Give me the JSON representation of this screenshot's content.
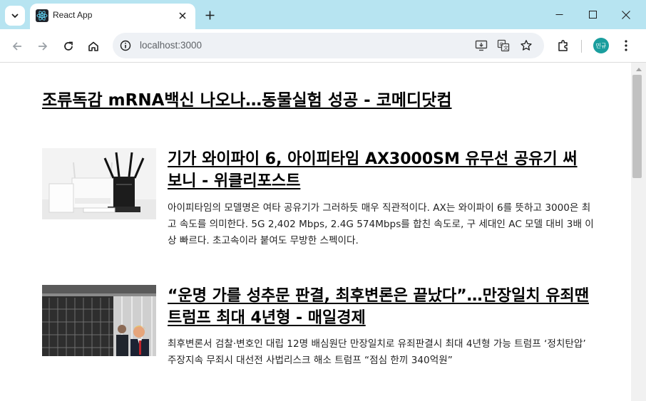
{
  "browser": {
    "tab": {
      "title": "React App",
      "favicon": "react-logo-icon"
    },
    "address_bar": {
      "url": "localhost:3000"
    },
    "profile": {
      "initials": "민규",
      "color": "#1a9e9e"
    },
    "colors": {
      "titlebar": "#b7e4f1",
      "omnibox": "#eef1f5"
    }
  },
  "page": {
    "headline": "조류독감 mRNA백신 나오나…동물실험 성공 - 코메디닷컴",
    "articles": [
      {
        "title": "기가 와이파이 6, 아이피타임 AX3000SM 유무선 공유기 써보니 - 위클리포스트",
        "summary": "아이피타임의 모델명은 여타 공유기가 그러하듯 매우 직관적이다. AX는 와이파이 6를 뜻하고 3000은 최고 속도를 의미한다. 5G 2,402 Mbps, 2.4G 574Mbps를 합친 속도로, 구 세대인 AC 모델 대비 3배 이상 빠르다. 초고속이라 붙여도 무방한 스펙이다.",
        "thumbnail": "router-photo"
      },
      {
        "title": "“운명 가를 성추문 판결, 최후변론은 끝났다”…만장일치 유죄땐 트럼프 최대 4년형 - 매일경제",
        "summary": "최후변론서 검찰·변호인 대립 12명 배심원단 만장일치로 유죄판결시 최대 4년형 가능 트럼프 ‘정치탄압’ 주장지속 무죄시 대선전 사법리스크 해소 트럼프 “점심 한끼 340억원”",
        "thumbnail": "courthouse-photo"
      }
    ]
  }
}
